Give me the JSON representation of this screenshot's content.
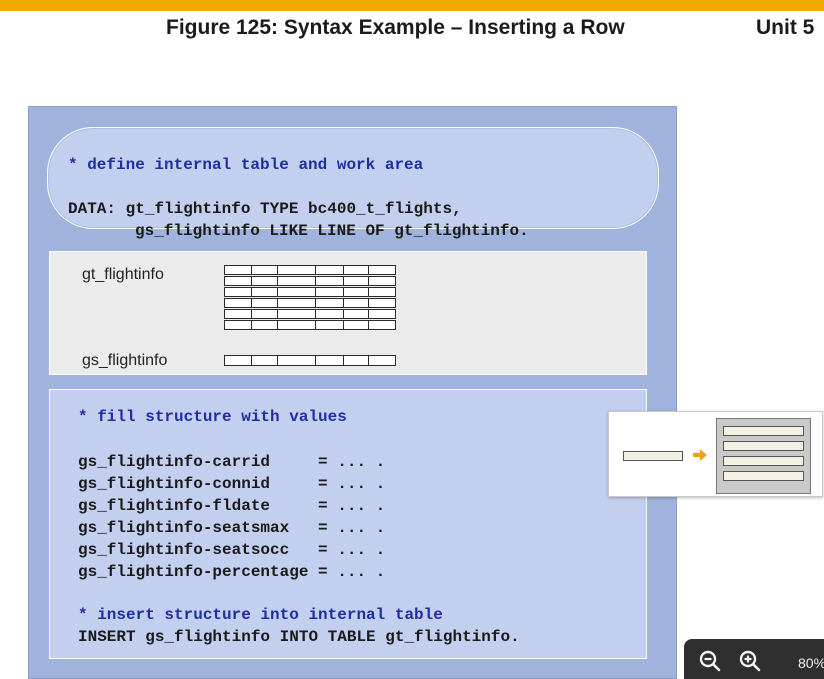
{
  "header": {
    "figure_title": "Figure 125: Syntax Example – Inserting a Row",
    "unit_label": "Unit 5",
    "accent_color": "#f0ab00"
  },
  "define_block": {
    "comment": "* define internal table and work area",
    "line1": "DATA: gt_flightinfo TYPE bc400_t_flights,",
    "line2": "gs_flightinfo LIKE LINE OF gt_flightinfo."
  },
  "diagram": {
    "table_label": "gt_flightinfo",
    "workarea_label": "gs_flightinfo"
  },
  "fill_block": {
    "comment": "* fill structure with values",
    "assignments": [
      "gs_flightinfo-carrid     = ... .",
      "gs_flightinfo-connid     = ... .",
      "gs_flightinfo-fldate     = ... .",
      "gs_flightinfo-seatsmax   = ... .",
      "gs_flightinfo-seatsocc   = ... .",
      "gs_flightinfo-percentage = ... ."
    ],
    "insert_comment": "* insert structure into internal table",
    "insert_stmt": "INSERT gs_flightinfo INTO TABLE gt_flightinfo."
  },
  "popup": {
    "icon": "insert-row-illustration"
  },
  "zoom": {
    "zoom_out_icon": "zoom-out-icon",
    "zoom_in_icon": "zoom-in-icon",
    "level": "80%"
  }
}
